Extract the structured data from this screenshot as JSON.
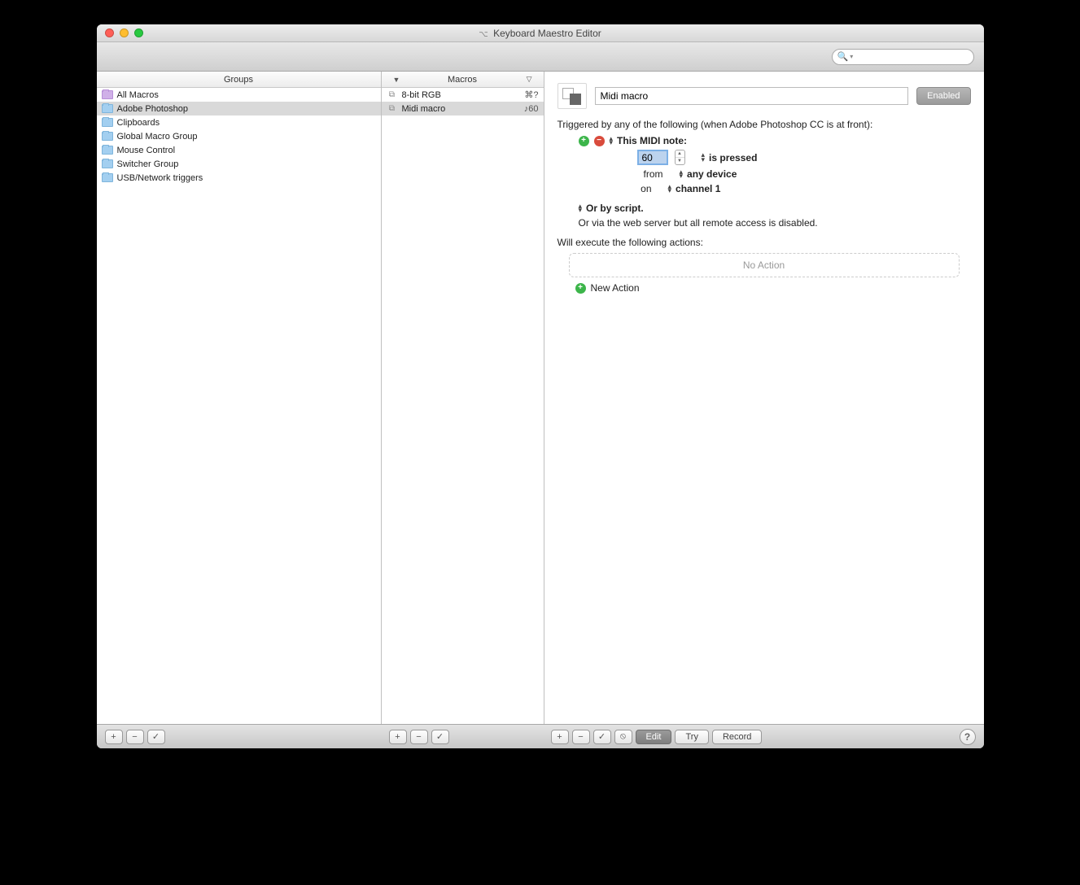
{
  "window": {
    "title": "Keyboard Maestro Editor"
  },
  "toolbar": {
    "search_placeholder": ""
  },
  "groups": {
    "header": "Groups",
    "items": [
      {
        "label": "All Macros",
        "selected": false,
        "purple": true
      },
      {
        "label": "Adobe Photoshop",
        "selected": true,
        "purple": false
      },
      {
        "label": "Clipboards",
        "selected": false,
        "purple": false
      },
      {
        "label": "Global Macro Group",
        "selected": false,
        "purple": false
      },
      {
        "label": "Mouse Control",
        "selected": false,
        "purple": false
      },
      {
        "label": "Switcher Group",
        "selected": false,
        "purple": false
      },
      {
        "label": "USB/Network triggers",
        "selected": false,
        "purple": false
      }
    ]
  },
  "macros": {
    "header": "Macros",
    "items": [
      {
        "label": "8-bit RGB",
        "shortcut": "⌘?",
        "selected": false
      },
      {
        "label": "Midi macro",
        "shortcut": "♪60",
        "selected": true
      }
    ]
  },
  "detail": {
    "name": "Midi macro",
    "enabled_label": "Enabled",
    "triggered_text": "Triggered by any of the following (when Adobe Photoshop CC is at front):",
    "trigger": {
      "type_label": "This MIDI note:",
      "note_value": "60",
      "press_label": "is pressed",
      "from_label": "from",
      "device_label": "any device",
      "on_label": "on",
      "channel_label": "channel 1"
    },
    "or_script": "Or by script.",
    "remote_text": "Or via the web server but all remote access is disabled.",
    "execute_text": "Will execute the following actions:",
    "no_action": "No Action",
    "new_action": "New Action"
  },
  "footer": {
    "edit": "Edit",
    "try": "Try",
    "record": "Record"
  }
}
